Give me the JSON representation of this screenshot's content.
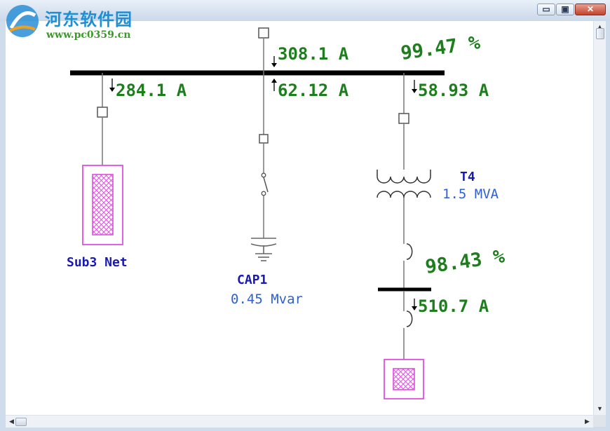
{
  "brand": {
    "name": "河东软件园",
    "url": "www.pc0359.cn"
  },
  "window": {
    "min_glyph": "▭",
    "max_glyph": "▣",
    "close_glyph": "✕"
  },
  "scrollbars": {
    "up": "▲",
    "down": "▼",
    "left": "◀",
    "right": "▶"
  },
  "diagram": {
    "main_bus": {
      "voltage_pct": "99.47 %",
      "incoming_current": "308.1 A"
    },
    "sub3": {
      "name": "Sub3 Net",
      "current": "284.1 A"
    },
    "cap1": {
      "name": "CAP1",
      "rating": "0.45 Mvar",
      "current": "62.12 A"
    },
    "t4": {
      "name": "T4",
      "rating": "1.5 MVA",
      "current": "58.93 A"
    },
    "secondary_bus": {
      "voltage_pct": "98.43 %",
      "current": "510.7 A"
    }
  },
  "colors": {
    "value_green": "#1e7e1e",
    "label_blue": "#1a1ab0",
    "rating_blue": "#2f5fd0",
    "element_magenta": "#e24ee2",
    "bus": "#000000"
  }
}
